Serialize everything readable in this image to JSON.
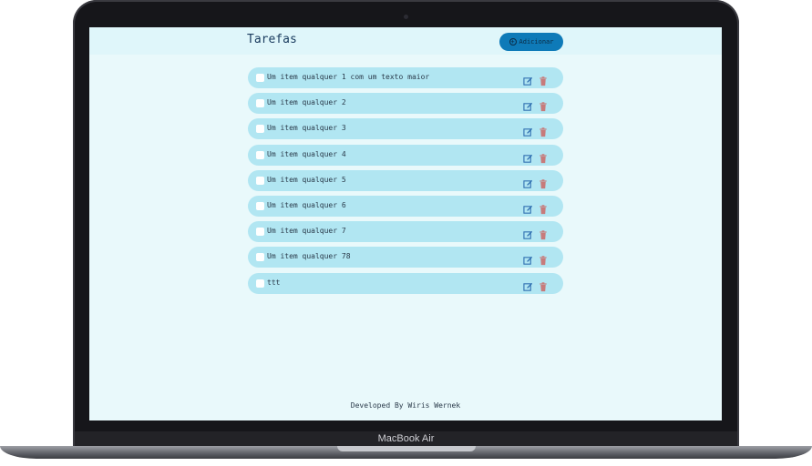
{
  "device": {
    "label": "MacBook Air"
  },
  "header": {
    "title": "Tarefas",
    "add_label": "Adicionar"
  },
  "tasks": [
    {
      "text": "Um item qualquer 1 com um texto maior",
      "checked": false
    },
    {
      "text": "Um item qualquer 2",
      "checked": false
    },
    {
      "text": "Um item qualquer 3",
      "checked": false
    },
    {
      "text": "Um item qualquer 4",
      "checked": false
    },
    {
      "text": "Um item qualquer 5",
      "checked": false
    },
    {
      "text": "Um item qualquer 6",
      "checked": false
    },
    {
      "text": "Um item qualquer 7",
      "checked": false
    },
    {
      "text": "Um item qualquer 78",
      "checked": false
    },
    {
      "text": "ttt",
      "checked": false
    }
  ],
  "icons": {
    "add": "plus-circle-icon",
    "edit": "edit-icon",
    "delete": "trash-icon"
  },
  "colors": {
    "accent": "#0e7ab8",
    "item_bg": "#b1e6f2",
    "page_bg": "#e9f9fb",
    "edit": "#2f6fb0",
    "delete": "#c77b7b"
  },
  "footer": {
    "text": "Developed By Wiris Wernek"
  }
}
